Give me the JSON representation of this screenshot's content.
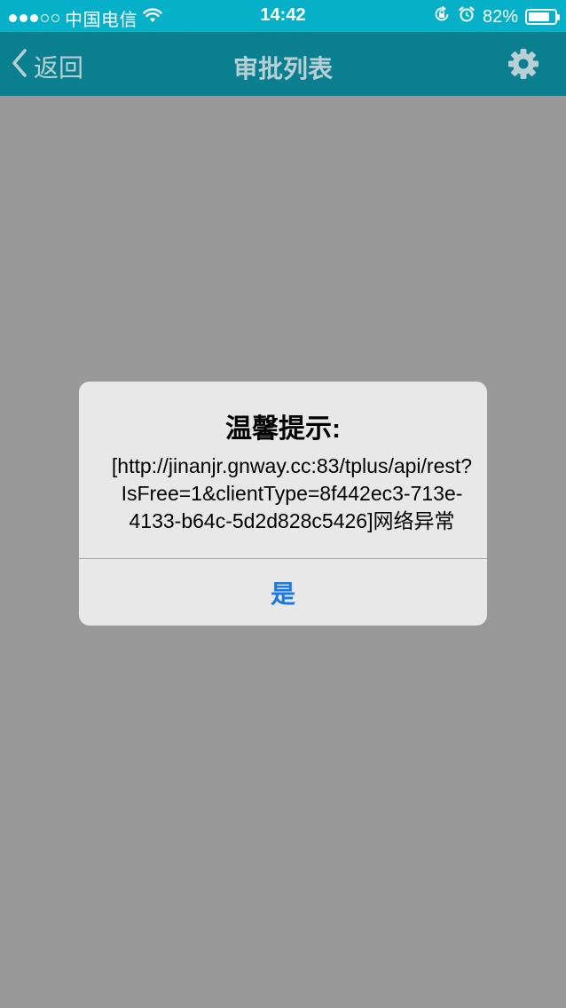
{
  "status_bar": {
    "carrier": "中国电信",
    "time": "14:42",
    "battery_percent": "82%",
    "battery_level": 0.82,
    "signal_bars": [
      true,
      true,
      true,
      false,
      false
    ],
    "icons": [
      "wifi-icon",
      "rotation-lock-icon",
      "alarm-icon",
      "battery-icon"
    ]
  },
  "nav": {
    "back_label": "返回",
    "title": "审批列表",
    "settings_icon": "gear-icon"
  },
  "alert": {
    "title": "温馨提示:",
    "message_lines": [
      "[http://jinanjr.gnway.cc:83/tplus/api/rest?",
      "IsFree=1&clientType=8f442ec3-713e-",
      "4133-b64c-5d2d828c5426]网络异常"
    ],
    "confirm_label": "是"
  },
  "colors": {
    "status_bar_bg": "#06b0c9",
    "nav_bar_bg_dimmed": "#0a7f90",
    "overlay_bg": "#999999",
    "alert_bg": "#e8e8e8",
    "alert_button": "#1a7ae0"
  }
}
